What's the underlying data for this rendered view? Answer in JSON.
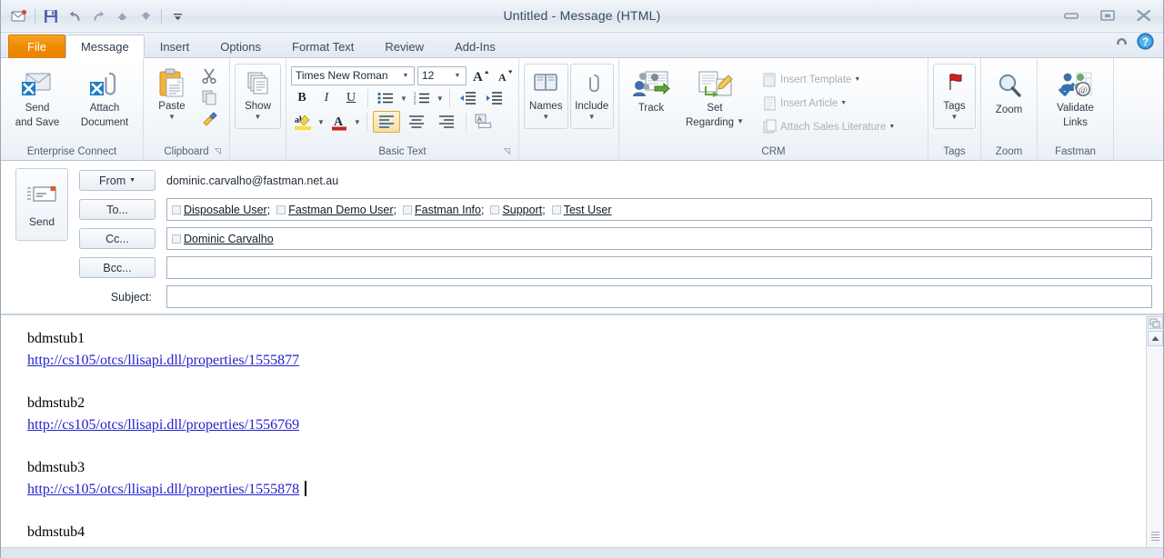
{
  "window": {
    "title": "Untitled  -  Message (HTML)",
    "controls": {
      "minimize": "minimize-button",
      "restore": "restore-button",
      "close": "close-button"
    }
  },
  "quick_access": [
    {
      "name": "send-receive-icon",
      "label": "Send/Receive"
    },
    {
      "name": "save-icon",
      "label": "Save"
    },
    {
      "name": "undo-icon",
      "label": "Undo"
    },
    {
      "name": "redo-icon",
      "label": "Redo"
    },
    {
      "name": "previous-item-icon",
      "label": "Previous Item"
    },
    {
      "name": "next-item-icon",
      "label": "Next Item"
    },
    {
      "name": "customize-qat-icon",
      "label": "Customize Quick Access Toolbar"
    }
  ],
  "tabs": [
    {
      "label": "File",
      "type": "file"
    },
    {
      "label": "Message",
      "type": "active"
    },
    {
      "label": "Insert",
      "type": "normal"
    },
    {
      "label": "Options",
      "type": "normal"
    },
    {
      "label": "Format Text",
      "type": "normal"
    },
    {
      "label": "Review",
      "type": "normal"
    },
    {
      "label": "Add-Ins",
      "type": "normal"
    }
  ],
  "tab_right": {
    "collapse_ribbon": "collapse-ribbon-icon",
    "help": "help-icon",
    "help_glyph": "?"
  },
  "ribbon": {
    "groups": [
      {
        "label": "Enterprise Connect",
        "dialog_launcher": false,
        "buttons": [
          {
            "name": "send-and-save-button",
            "label1": "Send",
            "label2": "and Save"
          },
          {
            "name": "attach-document-button",
            "label1": "Attach",
            "label2": "Document"
          }
        ]
      },
      {
        "label": "Clipboard",
        "dialog_launcher": true,
        "paste_label": "Paste",
        "small": [
          {
            "name": "cut-button",
            "label": "Cut"
          },
          {
            "name": "copy-button",
            "label": "Copy"
          },
          {
            "name": "format-painter-button",
            "label": "Format Painter"
          }
        ]
      },
      {
        "label": "",
        "dialog_launcher": false,
        "show_label": "Show"
      },
      {
        "label": "Basic Text",
        "dialog_launcher": true,
        "font_name": "Times New Roman",
        "font_size": "12",
        "grow_font": "A",
        "shrink_font": "A",
        "bold": "B",
        "italic": "I",
        "underline": "U",
        "bullets": "bullet-list",
        "numbering": "numbered-list",
        "decrease_indent": "decrease-indent",
        "increase_indent": "increase-indent",
        "highlight": "text-highlight",
        "font_color": "A",
        "align_left": "align-left",
        "align_center": "align-center",
        "align_right": "align-right",
        "clear_formatting": "clear-formatting"
      },
      {
        "label": "",
        "names_label": "Names",
        "include_label": "Include"
      },
      {
        "label": "CRM",
        "dialog_launcher": false,
        "track_label": "Track",
        "set_regarding_label1": "Set",
        "set_regarding_label2": "Regarding",
        "disabled_items": [
          {
            "name": "insert-template-item",
            "label": "Insert Template"
          },
          {
            "name": "insert-article-item",
            "label": "Insert Article"
          },
          {
            "name": "attach-sales-literature-item",
            "label": "Attach Sales Literature"
          }
        ]
      },
      {
        "label": "Tags",
        "tags_label": "Tags"
      },
      {
        "label": "Zoom",
        "zoom_label": "Zoom"
      },
      {
        "label": "Fastman",
        "validate_links_label1": "Validate",
        "validate_links_label2": "Links"
      }
    ]
  },
  "header": {
    "send_button": {
      "label": "Send",
      "icon": "send-envelope-icon"
    },
    "from": {
      "button": "From",
      "value": "dominic.carvalho@fastman.net.au"
    },
    "to": {
      "button": "To...",
      "recipients": [
        "Disposable User",
        "Fastman Demo User",
        "Fastman Info",
        "Support",
        "Test User"
      ],
      "separator": ";"
    },
    "cc": {
      "button": "Cc...",
      "recipients": [
        "Dominic Carvalho"
      ],
      "separator": ";"
    },
    "bcc": {
      "button": "Bcc...",
      "value": ""
    },
    "subject": {
      "label": "Subject:",
      "value": ""
    }
  },
  "body": {
    "blocks": [
      {
        "title": "bdmstub1",
        "url": "http://cs105/otcs/llisapi.dll/properties/1555877",
        "cursor": false
      },
      {
        "title": "bdmstub2",
        "url": "http://cs105/otcs/llisapi.dll/properties/1556769",
        "cursor": false
      },
      {
        "title": "bdmstub3",
        "url": "http://cs105/otcs/llisapi.dll/properties/1555878",
        "cursor": true
      },
      {
        "title": "bdmstub4",
        "url": "",
        "cursor": false
      }
    ]
  },
  "scrollbar": {
    "split_handle": "split-window-handle",
    "scroll_up": "scroll-up-button",
    "grip": "scroll-grip"
  },
  "colors": {
    "file_tab_orange": "#f08a00",
    "hyperlink_blue": "#2222cc",
    "ribbon_border": "#b8c4d1",
    "title_text": "#3b4a5a"
  }
}
